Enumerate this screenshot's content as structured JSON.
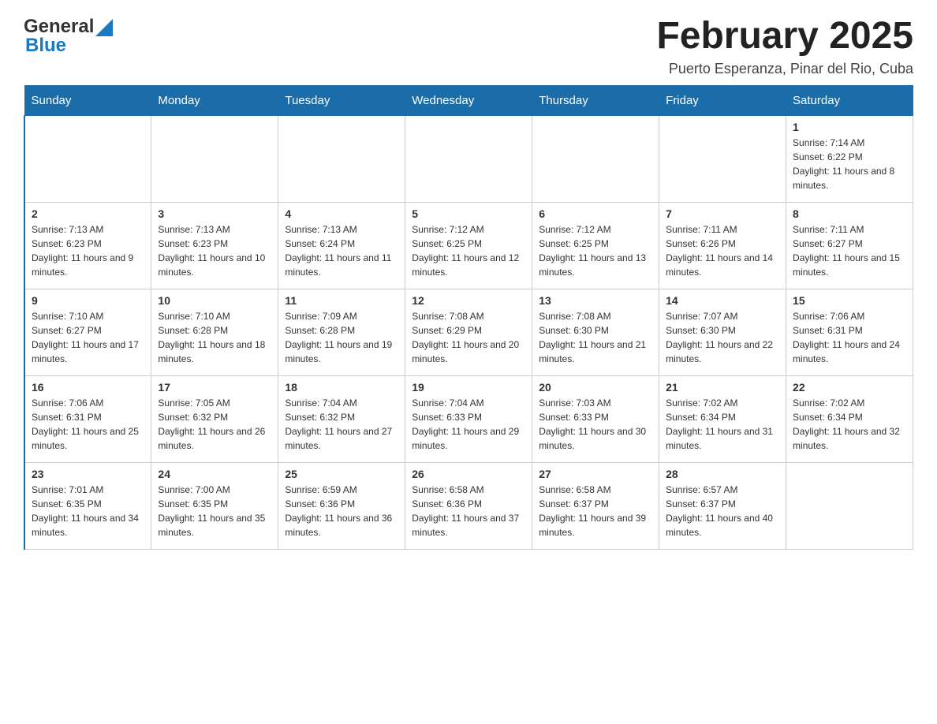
{
  "header": {
    "logo_general": "General",
    "logo_blue": "Blue",
    "month_title": "February 2025",
    "location": "Puerto Esperanza, Pinar del Rio, Cuba"
  },
  "weekdays": [
    "Sunday",
    "Monday",
    "Tuesday",
    "Wednesday",
    "Thursday",
    "Friday",
    "Saturday"
  ],
  "weeks": [
    [
      {
        "day": "",
        "info": ""
      },
      {
        "day": "",
        "info": ""
      },
      {
        "day": "",
        "info": ""
      },
      {
        "day": "",
        "info": ""
      },
      {
        "day": "",
        "info": ""
      },
      {
        "day": "",
        "info": ""
      },
      {
        "day": "1",
        "info": "Sunrise: 7:14 AM\nSunset: 6:22 PM\nDaylight: 11 hours and 8 minutes."
      }
    ],
    [
      {
        "day": "2",
        "info": "Sunrise: 7:13 AM\nSunset: 6:23 PM\nDaylight: 11 hours and 9 minutes."
      },
      {
        "day": "3",
        "info": "Sunrise: 7:13 AM\nSunset: 6:23 PM\nDaylight: 11 hours and 10 minutes."
      },
      {
        "day": "4",
        "info": "Sunrise: 7:13 AM\nSunset: 6:24 PM\nDaylight: 11 hours and 11 minutes."
      },
      {
        "day": "5",
        "info": "Sunrise: 7:12 AM\nSunset: 6:25 PM\nDaylight: 11 hours and 12 minutes."
      },
      {
        "day": "6",
        "info": "Sunrise: 7:12 AM\nSunset: 6:25 PM\nDaylight: 11 hours and 13 minutes."
      },
      {
        "day": "7",
        "info": "Sunrise: 7:11 AM\nSunset: 6:26 PM\nDaylight: 11 hours and 14 minutes."
      },
      {
        "day": "8",
        "info": "Sunrise: 7:11 AM\nSunset: 6:27 PM\nDaylight: 11 hours and 15 minutes."
      }
    ],
    [
      {
        "day": "9",
        "info": "Sunrise: 7:10 AM\nSunset: 6:27 PM\nDaylight: 11 hours and 17 minutes."
      },
      {
        "day": "10",
        "info": "Sunrise: 7:10 AM\nSunset: 6:28 PM\nDaylight: 11 hours and 18 minutes."
      },
      {
        "day": "11",
        "info": "Sunrise: 7:09 AM\nSunset: 6:28 PM\nDaylight: 11 hours and 19 minutes."
      },
      {
        "day": "12",
        "info": "Sunrise: 7:08 AM\nSunset: 6:29 PM\nDaylight: 11 hours and 20 minutes."
      },
      {
        "day": "13",
        "info": "Sunrise: 7:08 AM\nSunset: 6:30 PM\nDaylight: 11 hours and 21 minutes."
      },
      {
        "day": "14",
        "info": "Sunrise: 7:07 AM\nSunset: 6:30 PM\nDaylight: 11 hours and 22 minutes."
      },
      {
        "day": "15",
        "info": "Sunrise: 7:06 AM\nSunset: 6:31 PM\nDaylight: 11 hours and 24 minutes."
      }
    ],
    [
      {
        "day": "16",
        "info": "Sunrise: 7:06 AM\nSunset: 6:31 PM\nDaylight: 11 hours and 25 minutes."
      },
      {
        "day": "17",
        "info": "Sunrise: 7:05 AM\nSunset: 6:32 PM\nDaylight: 11 hours and 26 minutes."
      },
      {
        "day": "18",
        "info": "Sunrise: 7:04 AM\nSunset: 6:32 PM\nDaylight: 11 hours and 27 minutes."
      },
      {
        "day": "19",
        "info": "Sunrise: 7:04 AM\nSunset: 6:33 PM\nDaylight: 11 hours and 29 minutes."
      },
      {
        "day": "20",
        "info": "Sunrise: 7:03 AM\nSunset: 6:33 PM\nDaylight: 11 hours and 30 minutes."
      },
      {
        "day": "21",
        "info": "Sunrise: 7:02 AM\nSunset: 6:34 PM\nDaylight: 11 hours and 31 minutes."
      },
      {
        "day": "22",
        "info": "Sunrise: 7:02 AM\nSunset: 6:34 PM\nDaylight: 11 hours and 32 minutes."
      }
    ],
    [
      {
        "day": "23",
        "info": "Sunrise: 7:01 AM\nSunset: 6:35 PM\nDaylight: 11 hours and 34 minutes."
      },
      {
        "day": "24",
        "info": "Sunrise: 7:00 AM\nSunset: 6:35 PM\nDaylight: 11 hours and 35 minutes."
      },
      {
        "day": "25",
        "info": "Sunrise: 6:59 AM\nSunset: 6:36 PM\nDaylight: 11 hours and 36 minutes."
      },
      {
        "day": "26",
        "info": "Sunrise: 6:58 AM\nSunset: 6:36 PM\nDaylight: 11 hours and 37 minutes."
      },
      {
        "day": "27",
        "info": "Sunrise: 6:58 AM\nSunset: 6:37 PM\nDaylight: 11 hours and 39 minutes."
      },
      {
        "day": "28",
        "info": "Sunrise: 6:57 AM\nSunset: 6:37 PM\nDaylight: 11 hours and 40 minutes."
      },
      {
        "day": "",
        "info": ""
      }
    ]
  ]
}
